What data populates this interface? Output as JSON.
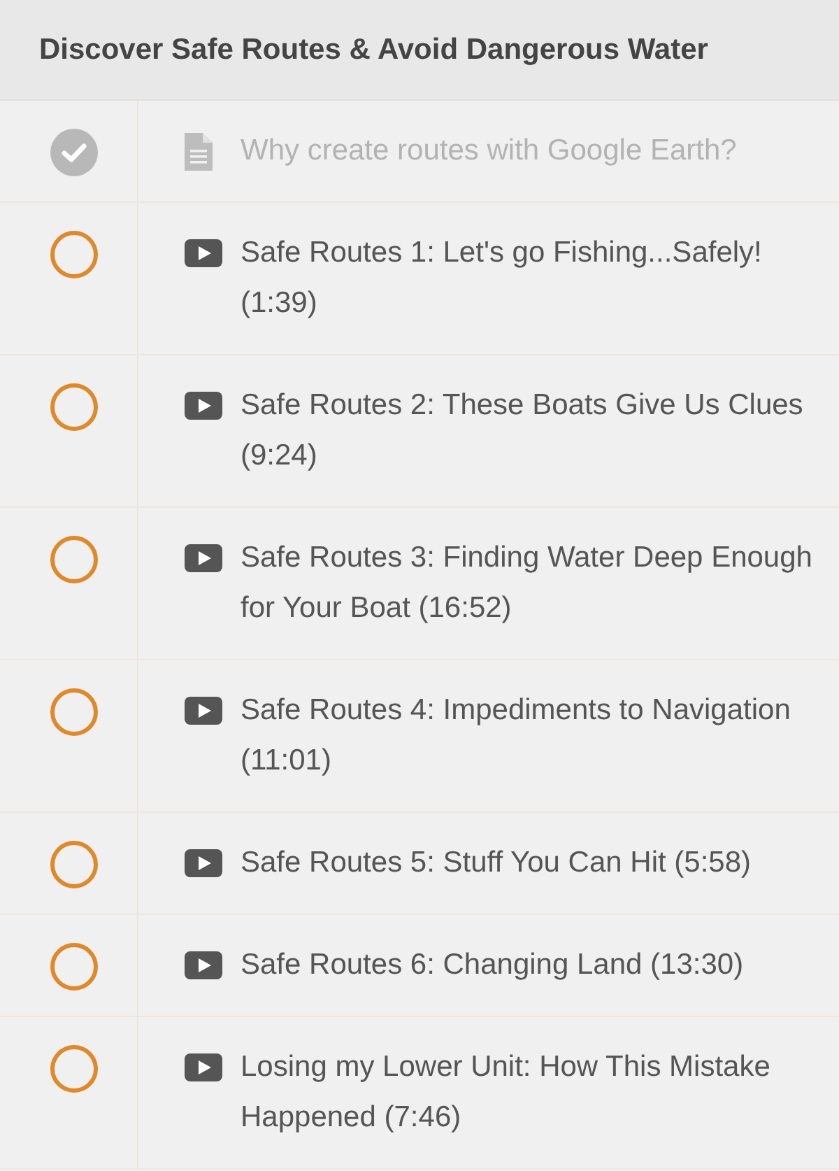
{
  "section": {
    "title": "Discover Safe Routes & Avoid Dangerous Water"
  },
  "lessons": [
    {
      "kind": "text",
      "title": "Why create routes with Google Earth?",
      "completed": true
    },
    {
      "kind": "video",
      "title": "Safe Routes 1: Let's go Fishing...Safely! (1:39)",
      "completed": false
    },
    {
      "kind": "video",
      "title": "Safe Routes 2: These Boats Give Us Clues (9:24)",
      "completed": false
    },
    {
      "kind": "video",
      "title": "Safe Routes 3: Finding Water Deep Enough for Your Boat (16:52)",
      "completed": false
    },
    {
      "kind": "video",
      "title": "Safe Routes 4: Impediments to Navigation (11:01)",
      "completed": false
    },
    {
      "kind": "video",
      "title": "Safe Routes 5: Stuff You Can Hit (5:58)",
      "completed": false
    },
    {
      "kind": "video",
      "title": "Safe Routes 6: Changing Land (13:30)",
      "completed": false
    },
    {
      "kind": "video",
      "title": "Losing my Lower Unit: How This Mistake Happened (7:46)",
      "completed": false
    }
  ]
}
